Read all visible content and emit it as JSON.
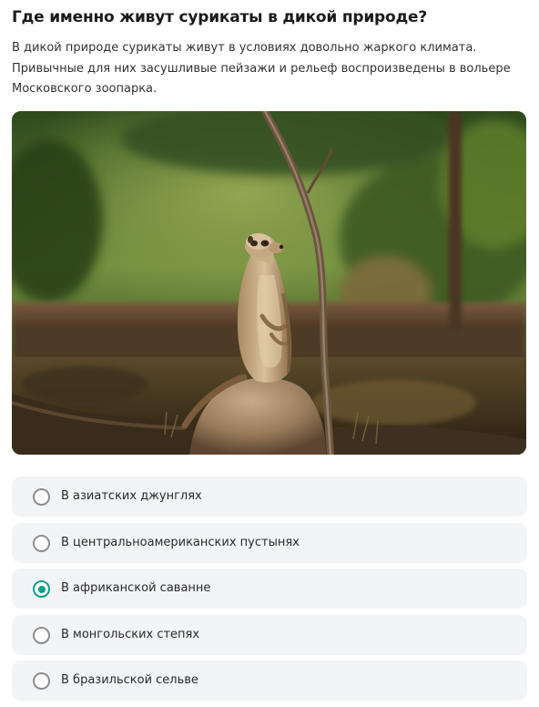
{
  "question": {
    "title": "Где именно живут сурикаты в дикой природе?",
    "description": "В дикой природе сурикаты живут в условиях довольно жаркого климата. Привычные для них засушливые пейзажи и рельеф воспроизведены в вольере Московского зоопарка."
  },
  "photo": {
    "subject": "meerkat-standing-on-rock"
  },
  "options": [
    {
      "label": "В азиатских джунглях",
      "selected": false
    },
    {
      "label": "В центральноамериканских пустынях",
      "selected": false
    },
    {
      "label": "В африканской саванне",
      "selected": true
    },
    {
      "label": "В монгольских степях",
      "selected": false
    },
    {
      "label": "В бразильской сельве",
      "selected": false
    }
  ],
  "colors": {
    "accent": "#0f9e86",
    "option_bg": "#f3f4f6",
    "radio_border": "#8e8e8e"
  }
}
